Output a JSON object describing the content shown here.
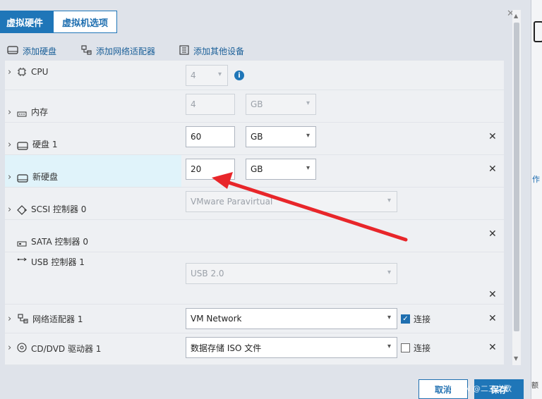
{
  "tabs": [
    {
      "label": "虚拟硬件"
    },
    {
      "label": "虚拟机选项"
    }
  ],
  "toolbar": {
    "add_disk": "添加硬盘",
    "add_nic": "添加网络适配器",
    "add_other": "添加其他设备"
  },
  "rows": {
    "cpu": {
      "label": "CPU",
      "value": "4"
    },
    "memory": {
      "label": "内存",
      "value": "4",
      "unit": "GB"
    },
    "disk1": {
      "label": "硬盘 1",
      "value": "60",
      "unit": "GB"
    },
    "newdisk": {
      "label": "新硬盘",
      "value": "20",
      "unit": "GB"
    },
    "scsi": {
      "label": "SCSI 控制器 0",
      "value": "VMware Paravirtual"
    },
    "sata": {
      "label": "SATA 控制器 0"
    },
    "usb": {
      "label": "USB 控制器 1",
      "value": "USB 2.0"
    },
    "nic": {
      "label": "网络适配器 1",
      "value": "VM Network",
      "connect_label": "连接",
      "connected": true
    },
    "cdrom": {
      "label": "CD/DVD 驱动器 1",
      "value": "数据存储 ISO 文件",
      "connect_label": "连接",
      "connected": false
    }
  },
  "footer": {
    "cancel": "取消",
    "save": "保存",
    "watermark": "CSDN @二三之歌"
  },
  "side": {
    "partial_text": "作",
    "partial_text2": "额"
  },
  "colors": {
    "accent": "#1f76b8",
    "selected_row": "#e0f3fa",
    "arrow": "#e8262a"
  }
}
